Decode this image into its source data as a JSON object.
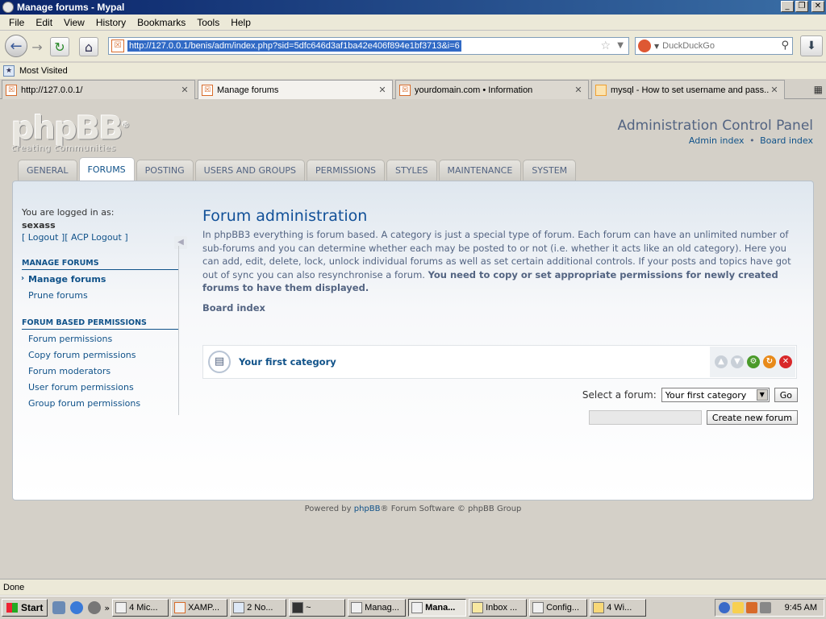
{
  "window": {
    "title": "Manage forums - Mypal"
  },
  "menubar": {
    "items": [
      "File",
      "Edit",
      "View",
      "History",
      "Bookmarks",
      "Tools",
      "Help"
    ]
  },
  "navbar": {
    "url": "http://127.0.0.1/benis/adm/index.php?sid=5dfc646d3af1ba42e406f894e1bf3713&i=6",
    "search_placeholder": "DuckDuckGo"
  },
  "bookmarks": {
    "most_visited": "Most Visited"
  },
  "tabs": [
    {
      "label": "http://127.0.0.1/"
    },
    {
      "label": "Manage forums"
    },
    {
      "label": "yourdomain.com • Information"
    },
    {
      "label": "mysql - How to set username and pass..."
    }
  ],
  "header": {
    "logo_text": "phpBB",
    "logo_sub": "creating communities",
    "logo_mark": "®",
    "acp_title": "Administration Control Panel",
    "admin_index": "Admin index",
    "separator": "•",
    "board_index": "Board index"
  },
  "acp_tabs": [
    "GENERAL",
    "FORUMS",
    "POSTING",
    "USERS AND GROUPS",
    "PERMISSIONS",
    "STYLES",
    "MAINTENANCE",
    "SYSTEM"
  ],
  "sidebar": {
    "logged_in_as": "You are logged in as:",
    "username": "sexass",
    "logout_links": "[ Logout ][ ACP Logout ]",
    "section1": "MANAGE FORUMS",
    "section1_items": [
      "Manage forums",
      "Prune forums"
    ],
    "section2": "FORUM BASED PERMISSIONS",
    "section2_items": [
      "Forum permissions",
      "Copy forum permissions",
      "Forum moderators",
      "User forum permissions",
      "Group forum permissions"
    ]
  },
  "main": {
    "title": "Forum administration",
    "desc": "In phpBB3 everything is forum based. A category is just a special type of forum. Each forum can have an unlimited number of sub-forums and you can determine whether each may be posted to or not (i.e. whether it acts like an old category). Here you can add, edit, delete, lock, unlock individual forums as well as set certain additional controls. If your posts and topics have got out of sync you can also resynchronise a forum.",
    "desc_bold": "You need to copy or set appropriate permissions for newly created forums to have them displayed.",
    "board_index": "Board index",
    "category_name": "Your first category",
    "select_label": "Select a forum:",
    "select_value": "Your first category",
    "go_label": "Go",
    "new_forum_value": "",
    "create_label": "Create new forum"
  },
  "footer": {
    "prefix": "Powered by",
    "link": "phpBB",
    "suffix": "® Forum Software © phpBB Group"
  },
  "statusbar": {
    "text": "Done"
  },
  "taskbar": {
    "start": "Start",
    "tasks": [
      "4 Mic...",
      "XAMP...",
      "2 No...",
      "~",
      "Manag...",
      "Mana...",
      "Inbox ...",
      "Config...",
      "4 Wi..."
    ],
    "clock": "9:45 AM"
  }
}
